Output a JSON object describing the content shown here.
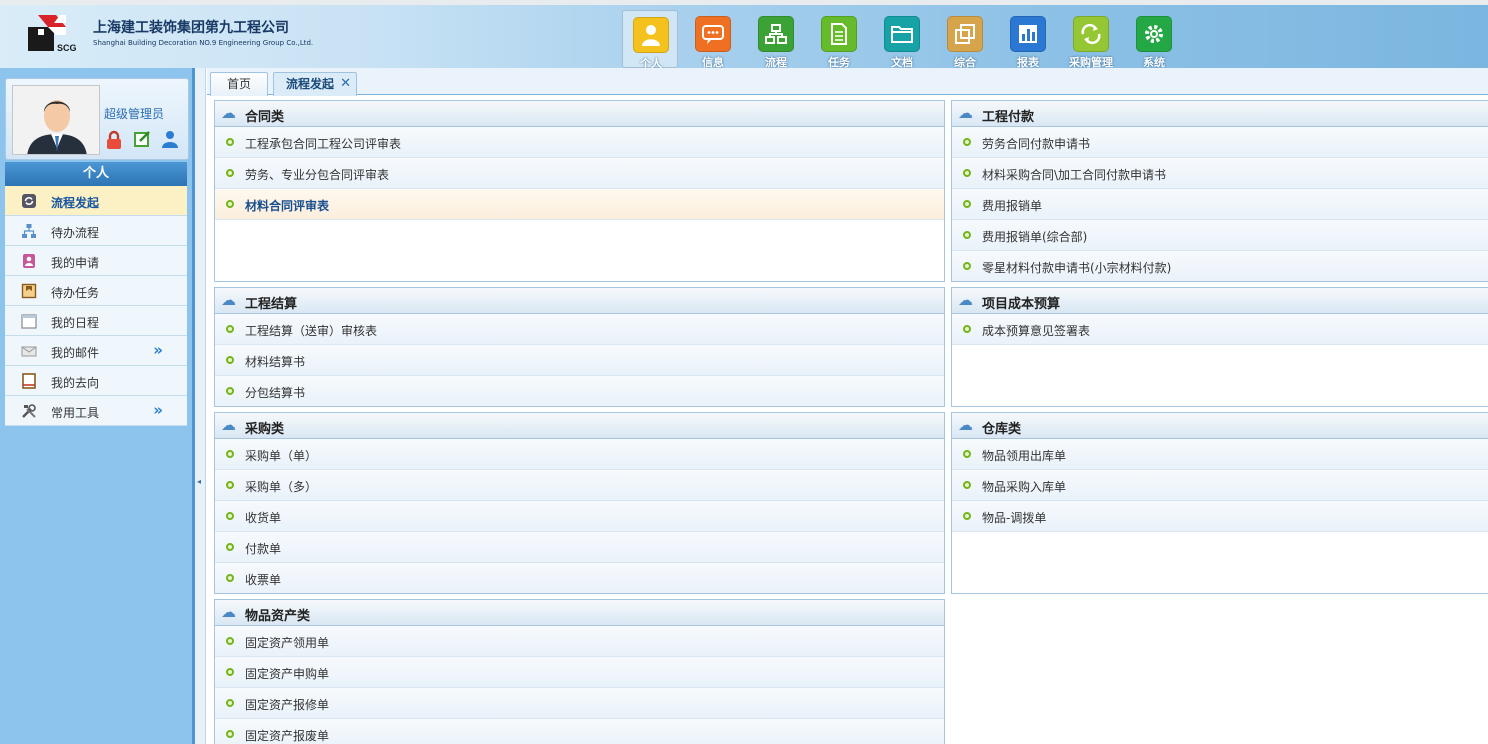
{
  "header": {
    "company_cn": "上海建工装饰集团第九工程公司",
    "company_en": "Shanghai Building Decoration NO.9 Engineering Group Co.,Ltd.",
    "logo_text": "SCG",
    "nav": [
      {
        "label": "个人",
        "icon": "person-icon",
        "color": "#f5c21d",
        "active": true
      },
      {
        "label": "信息",
        "icon": "message-icon",
        "color": "#ef7023"
      },
      {
        "label": "流程",
        "icon": "flowchart-icon",
        "color": "#3ba335"
      },
      {
        "label": "任务",
        "icon": "document-icon",
        "color": "#66bb2b"
      },
      {
        "label": "文档",
        "icon": "folder-icon",
        "color": "#17a3a6"
      },
      {
        "label": "综合",
        "icon": "composite-icon",
        "color": "#d6a44a"
      },
      {
        "label": "报表",
        "icon": "bar-chart-icon",
        "color": "#2a78d4"
      },
      {
        "label": "采购管理",
        "icon": "recycle-icon",
        "color": "#95c634"
      },
      {
        "label": "系统",
        "icon": "gear-icon",
        "color": "#24a845"
      }
    ]
  },
  "sidebar": {
    "user_role": "超级管理员",
    "section_title": "个人",
    "items": [
      {
        "label": "流程发起",
        "icon": "refresh-icon",
        "active": true
      },
      {
        "label": "待办流程",
        "icon": "org-chart-icon"
      },
      {
        "label": "我的申请",
        "icon": "user-form-icon"
      },
      {
        "label": "待办任务",
        "icon": "task-icon"
      },
      {
        "label": "我的日程",
        "icon": "calendar-icon"
      },
      {
        "label": "我的邮件",
        "icon": "mail-icon",
        "expandable": true
      },
      {
        "label": "我的去向",
        "icon": "notebook-icon"
      },
      {
        "label": "常用工具",
        "icon": "tools-icon",
        "expandable": true
      }
    ],
    "expand_glyph": "»"
  },
  "tabs": [
    {
      "label": "首页"
    },
    {
      "label": "流程发起",
      "active": true,
      "close": "✕"
    }
  ],
  "panels": {
    "contract": {
      "title": "合同类",
      "items": [
        "工程承包合同工程公司评审表",
        "劳务、专业分包合同评审表",
        "材料合同评审表"
      ]
    },
    "payment": {
      "title": "工程付款",
      "items": [
        "劳务合同付款申请书",
        "材料采购合同\\加工合同付款申请书",
        "费用报销单",
        "费用报销单(综合部)",
        "零星材料付款申请书(小宗材料付款)"
      ]
    },
    "settlement": {
      "title": "工程结算",
      "items": [
        "工程结算（送审）审核表",
        "材料结算书",
        "分包结算书"
      ]
    },
    "budget": {
      "title": "项目成本预算",
      "items": [
        "成本预算意见签署表"
      ]
    },
    "purchase": {
      "title": "采购类",
      "items": [
        "采购单（单）",
        "采购单（多）",
        "收货单",
        "付款单",
        "收票单"
      ]
    },
    "warehouse": {
      "title": "仓库类",
      "items": [
        "物品领用出库单",
        "物品采购入库单",
        "物品-调拨单"
      ]
    },
    "assets": {
      "title": "物品资产类",
      "items": [
        "固定资产领用单",
        "固定资产申购单",
        "固定资产报修单",
        "固定资产报废单"
      ]
    }
  }
}
